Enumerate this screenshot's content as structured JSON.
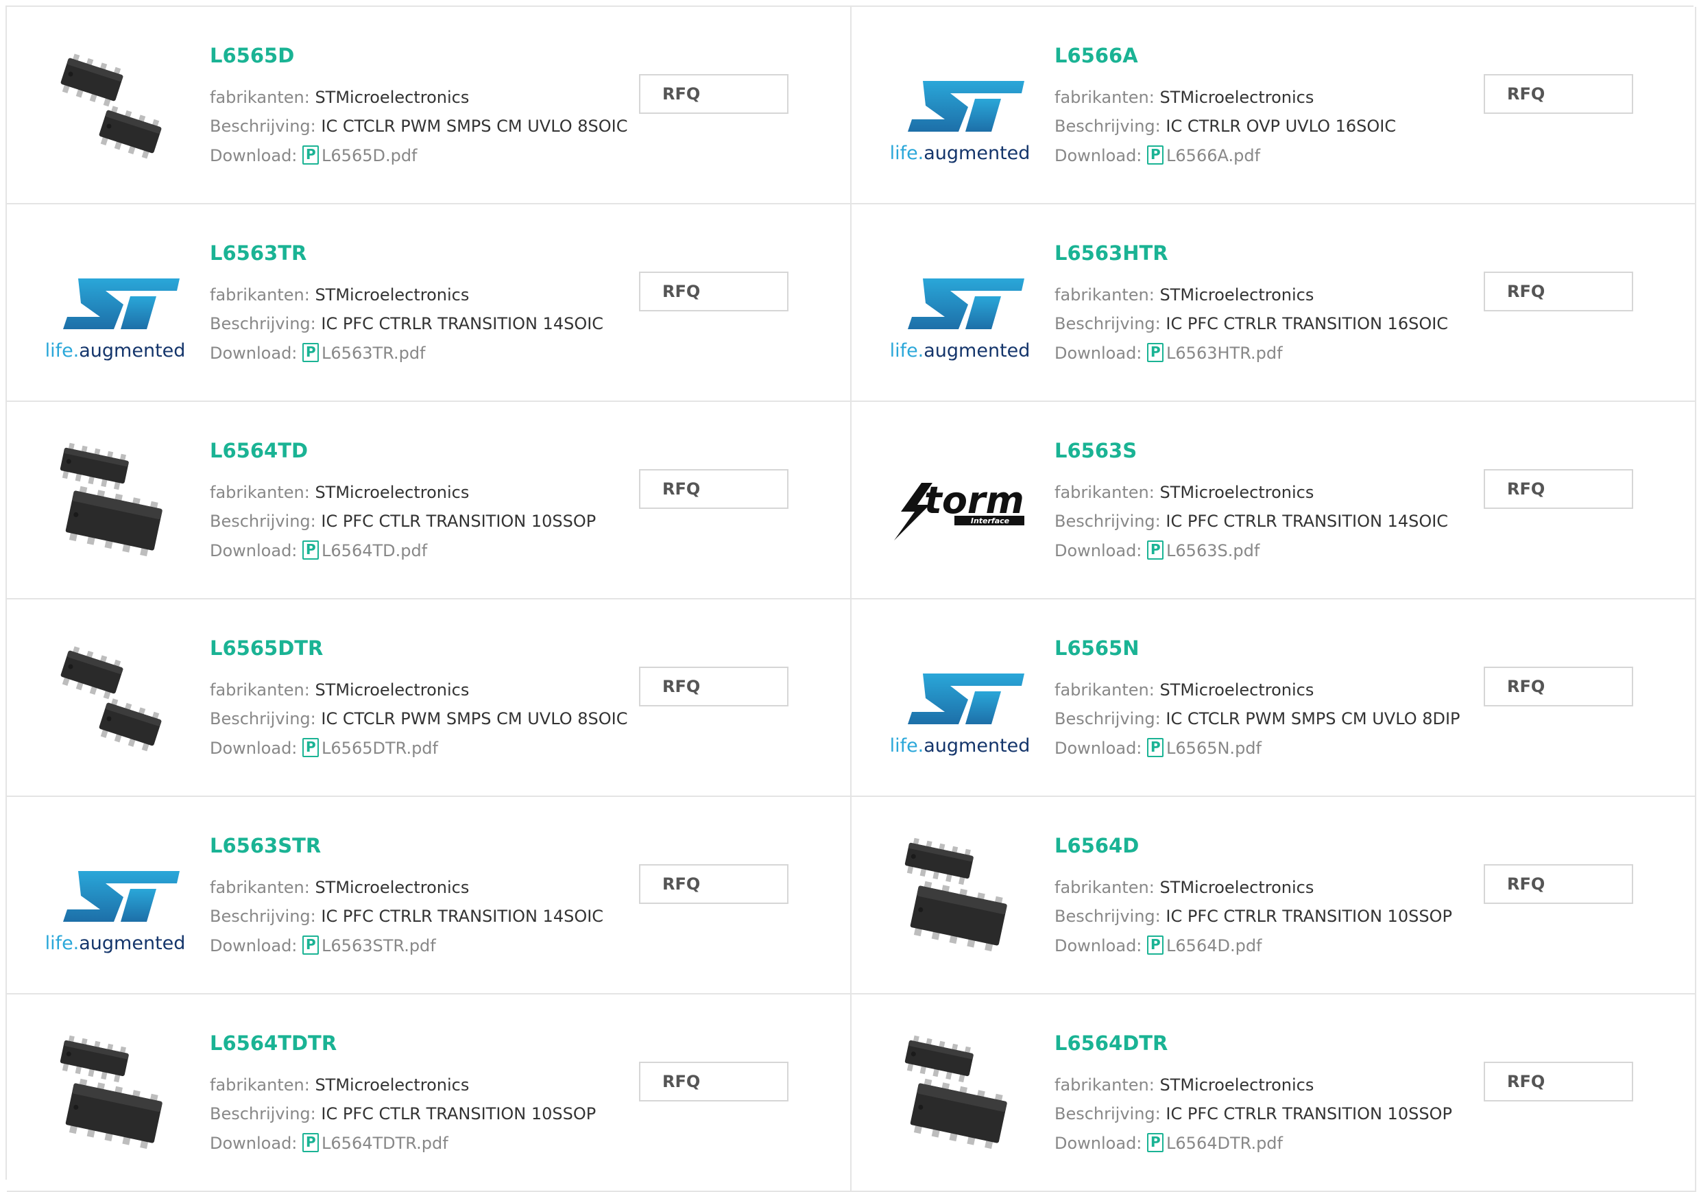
{
  "labels": {
    "manufacturer": "fabrikanten:",
    "description": "Beschrijving:",
    "download": "Download:",
    "rfq": "RFQ"
  },
  "products": [
    {
      "part": "L6565D",
      "manufacturer": "STMicroelectronics",
      "description": "IC CTCLR PWM SMPS CM UVLO 8SOIC",
      "pdf": "L6565D.pdf",
      "image": "ic-8pin-image"
    },
    {
      "part": "L6566A",
      "manufacturer": "STMicroelectronics",
      "description": "IC CTRLR OVP UVLO 16SOIC",
      "pdf": "L6566A.pdf",
      "image": "st-logo"
    },
    {
      "part": "L6563TR",
      "manufacturer": "STMicroelectronics",
      "description": "IC PFC CTRLR TRANSITION 14SOIC",
      "pdf": "L6563TR.pdf",
      "image": "st-logo"
    },
    {
      "part": "L6563HTR",
      "manufacturer": "STMicroelectronics",
      "description": "IC PFC CTRLR TRANSITION 16SOIC",
      "pdf": "L6563HTR.pdf",
      "image": "st-logo"
    },
    {
      "part": "L6564TD",
      "manufacturer": "STMicroelectronics",
      "description": "IC PFC CTLR TRANSITION 10SSOP",
      "pdf": "L6564TD.pdf",
      "image": "ic-10pin-image"
    },
    {
      "part": "L6563S",
      "manufacturer": "STMicroelectronics",
      "description": "IC PFC CTRLR TRANSITION 14SOIC",
      "pdf": "L6563S.pdf",
      "image": "storm-logo"
    },
    {
      "part": "L6565DTR",
      "manufacturer": "STMicroelectronics",
      "description": "IC CTCLR PWM SMPS CM UVLO 8SOIC",
      "pdf": "L6565DTR.pdf",
      "image": "ic-8pin-image"
    },
    {
      "part": "L6565N",
      "manufacturer": "STMicroelectronics",
      "description": "IC CTCLR PWM SMPS CM UVLO 8DIP",
      "pdf": "L6565N.pdf",
      "image": "st-logo"
    },
    {
      "part": "L6563STR",
      "manufacturer": "STMicroelectronics",
      "description": "IC PFC CTRLR TRANSITION 14SOIC",
      "pdf": "L6563STR.pdf",
      "image": "st-logo"
    },
    {
      "part": "L6564D",
      "manufacturer": "STMicroelectronics",
      "description": "IC PFC CTRLR TRANSITION 10SSOP",
      "pdf": "L6564D.pdf",
      "image": "ic-10pin-image"
    },
    {
      "part": "L6564TDTR",
      "manufacturer": "STMicroelectronics",
      "description": "IC PFC CTLR TRANSITION 10SSOP",
      "pdf": "L6564TDTR.pdf",
      "image": "ic-10pin-image"
    },
    {
      "part": "L6564DTR",
      "manufacturer": "STMicroelectronics",
      "description": "IC PFC CTRLR TRANSITION 10SSOP",
      "pdf": "L6564DTR.pdf",
      "image": "ic-10pin-image"
    }
  ],
  "logos": {
    "st_tagline_a": "life.",
    "st_tagline_b": "augmented",
    "storm_word": "torm",
    "storm_sub": "Interface"
  },
  "colors": {
    "accent": "#1ab394",
    "st_blue": "#2aa7d9",
    "st_navy": "#14356b",
    "border": "#e4e4e4"
  }
}
